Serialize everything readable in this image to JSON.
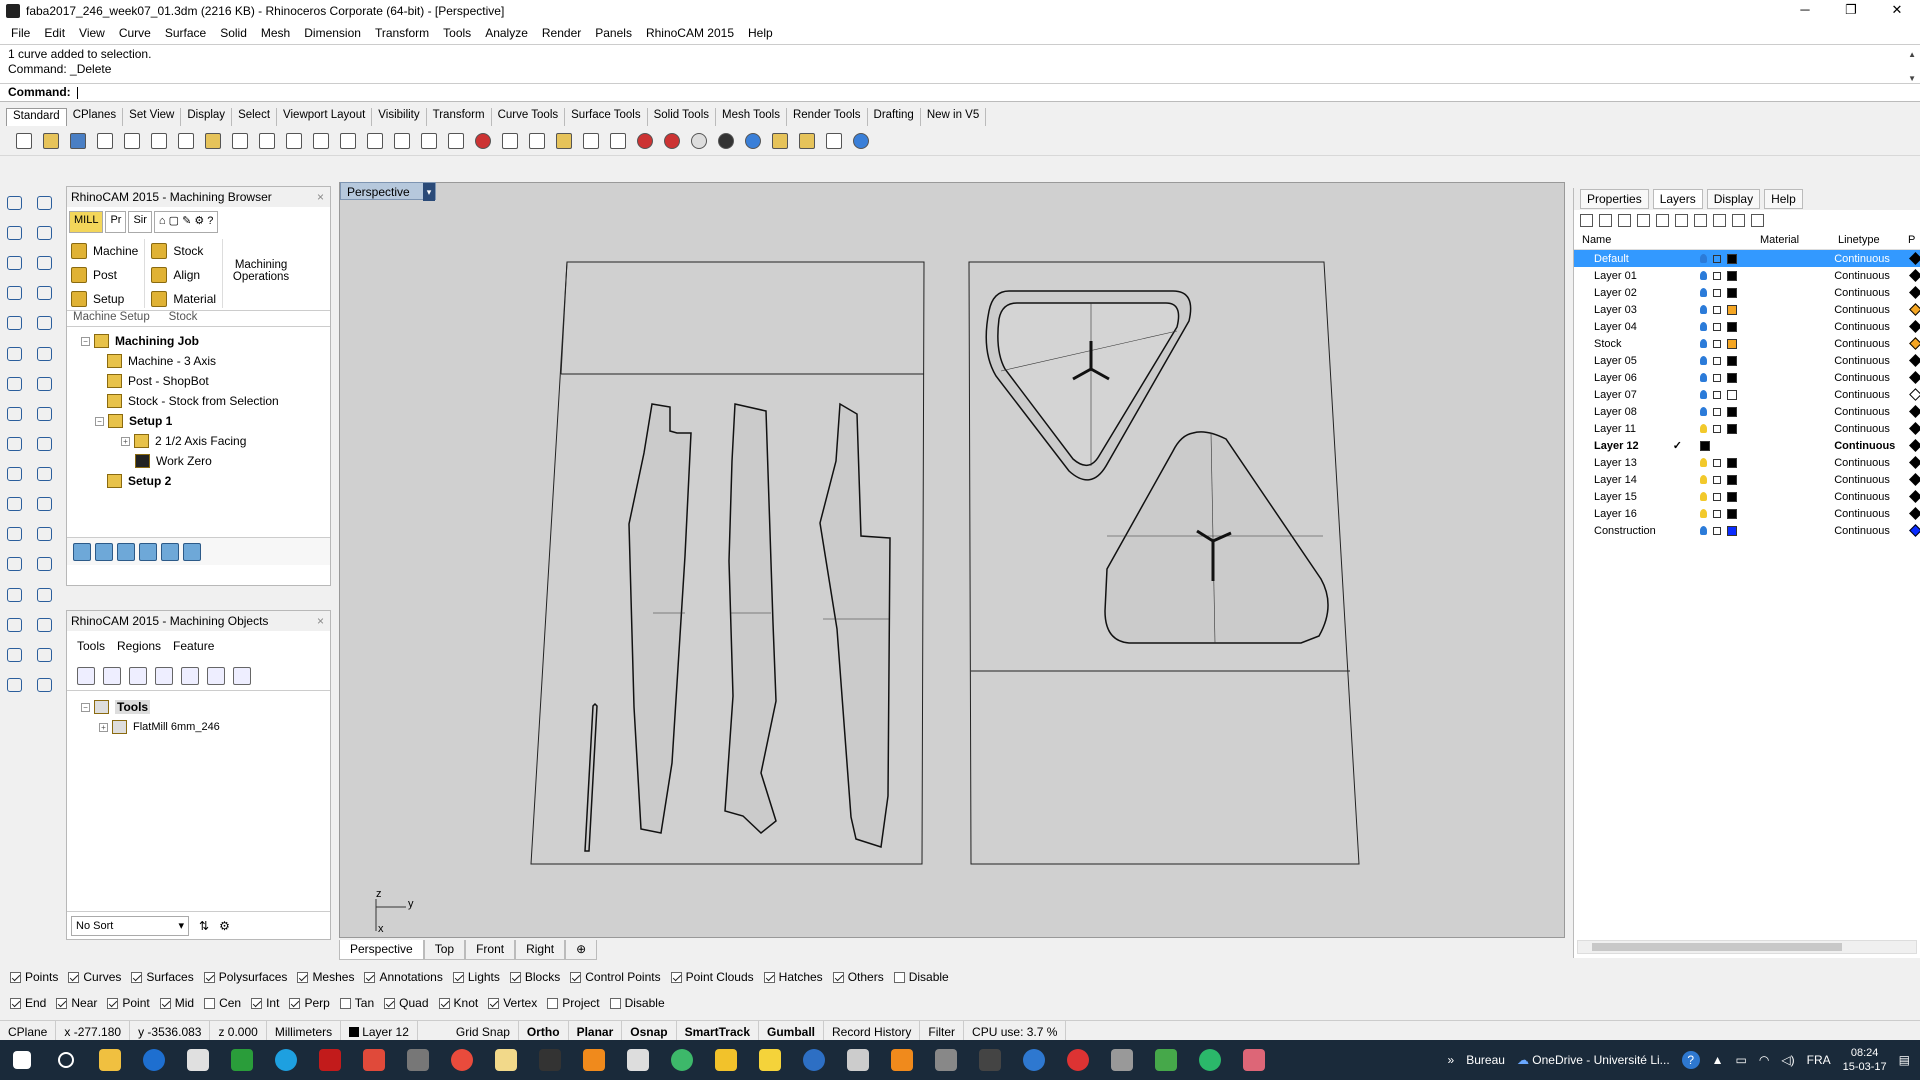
{
  "window": {
    "title": "faba2017_246_week07_01.3dm (2216 KB) - Rhinoceros Corporate (64-bit) - [Perspective]",
    "minimize": "─",
    "maximize": "❐",
    "close": "✕"
  },
  "menu": [
    "File",
    "Edit",
    "View",
    "Curve",
    "Surface",
    "Solid",
    "Mesh",
    "Dimension",
    "Transform",
    "Tools",
    "Analyze",
    "Render",
    "Panels",
    "RhinoCAM 2015",
    "Help"
  ],
  "command": {
    "history": [
      "1 curve added to selection.",
      "Command: _Delete"
    ],
    "prompt": "Command:"
  },
  "toolbar_tabs": [
    "Standard",
    "CPlanes",
    "Set View",
    "Display",
    "Select",
    "Viewport Layout",
    "Visibility",
    "Transform",
    "Curve Tools",
    "Surface Tools",
    "Solid Tools",
    "Mesh Tools",
    "Render Tools",
    "Drafting",
    "New in V5"
  ],
  "browser": {
    "title": "RhinoCAM 2015 - Machining Browser",
    "tabs": [
      "MILL",
      "Pr",
      "Sir"
    ],
    "ribbon": {
      "machine_setup": {
        "items": [
          "Machine",
          "Post",
          "Setup"
        ],
        "label": "Machine Setup"
      },
      "stock": {
        "items": [
          "Stock",
          "Align",
          "Material"
        ],
        "label": "Stock"
      },
      "ops": "Machining Operations"
    },
    "tree": [
      {
        "label": "Machining Job",
        "level": 0,
        "bold": true
      },
      {
        "label": "Machine - 3 Axis",
        "level": 1,
        "bold": false
      },
      {
        "label": "Post - ShopBot",
        "level": 1,
        "bold": false
      },
      {
        "label": "Stock - Stock from Selection",
        "level": 1,
        "bold": false
      },
      {
        "label": "Setup 1",
        "level": 1,
        "bold": true
      },
      {
        "label": "2 1/2 Axis Facing",
        "level": 2,
        "bold": false
      },
      {
        "label": "Work Zero",
        "level": 2,
        "bold": false
      },
      {
        "label": "Setup 2",
        "level": 1,
        "bold": true
      }
    ]
  },
  "objects": {
    "title": "RhinoCAM 2015 - Machining Objects",
    "tabs": [
      "Tools",
      "Regions",
      "Feature"
    ],
    "tree": [
      {
        "label": "Tools",
        "level": 0
      },
      {
        "label": "FlatMill 6mm_246",
        "level": 1
      }
    ],
    "sort": "No Sort"
  },
  "viewport": {
    "name": "Perspective",
    "tabs": [
      "Perspective",
      "Top",
      "Front",
      "Right"
    ],
    "axis_z": "z",
    "axis_y": "y",
    "axis_x": "x"
  },
  "right_panel": {
    "tabs": [
      "Properties",
      "Layers",
      "Display",
      "Help"
    ],
    "headers": {
      "name": "Name",
      "material": "Material",
      "linetype": "Linetype",
      "extra": "P"
    },
    "layers": [
      {
        "name": "Default",
        "on": true,
        "color": "#000000",
        "linetype": "Continuous",
        "selected": true
      },
      {
        "name": "Layer 01",
        "on": true,
        "color": "#000000",
        "linetype": "Continuous"
      },
      {
        "name": "Layer 02",
        "on": true,
        "color": "#000000",
        "linetype": "Continuous"
      },
      {
        "name": "Layer 03",
        "on": true,
        "color": "#f5a623",
        "linetype": "Continuous"
      },
      {
        "name": "Layer 04",
        "on": true,
        "color": "#000000",
        "linetype": "Continuous"
      },
      {
        "name": "Stock",
        "on": true,
        "color": "#f5a623",
        "linetype": "Continuous"
      },
      {
        "name": "Layer 05",
        "on": true,
        "color": "#000000",
        "linetype": "Continuous"
      },
      {
        "name": "Layer 06",
        "on": true,
        "color": "#000000",
        "linetype": "Continuous"
      },
      {
        "name": "Layer 07",
        "on": true,
        "color": "#ffffff",
        "linetype": "Continuous"
      },
      {
        "name": "Layer 08",
        "on": true,
        "color": "#000000",
        "linetype": "Continuous"
      },
      {
        "name": "Layer 11",
        "on": false,
        "color": "#000000",
        "linetype": "Continuous"
      },
      {
        "name": "Layer 12",
        "on": null,
        "color": "#000000",
        "linetype": "Continuous",
        "current": true,
        "mark": "✓"
      },
      {
        "name": "Layer 13",
        "on": false,
        "color": "#000000",
        "linetype": "Continuous"
      },
      {
        "name": "Layer 14",
        "on": false,
        "color": "#000000",
        "linetype": "Continuous"
      },
      {
        "name": "Layer 15",
        "on": false,
        "color": "#000000",
        "linetype": "Continuous"
      },
      {
        "name": "Layer 16",
        "on": false,
        "color": "#000000",
        "linetype": "Continuous"
      },
      {
        "name": "Construction",
        "on": true,
        "color": "#0a2cff",
        "linetype": "Continuous"
      }
    ]
  },
  "filters": [
    {
      "label": "Points",
      "on": true
    },
    {
      "label": "Curves",
      "on": true
    },
    {
      "label": "Surfaces",
      "on": true
    },
    {
      "label": "Polysurfaces",
      "on": true
    },
    {
      "label": "Meshes",
      "on": true
    },
    {
      "label": "Annotations",
      "on": true
    },
    {
      "label": "Lights",
      "on": true
    },
    {
      "label": "Blocks",
      "on": true
    },
    {
      "label": "Control Points",
      "on": true
    },
    {
      "label": "Point Clouds",
      "on": true
    },
    {
      "label": "Hatches",
      "on": true
    },
    {
      "label": "Others",
      "on": true
    },
    {
      "label": "Disable",
      "on": false
    }
  ],
  "osnaps": [
    {
      "label": "End",
      "on": true
    },
    {
      "label": "Near",
      "on": true
    },
    {
      "label": "Point",
      "on": true
    },
    {
      "label": "Mid",
      "on": true
    },
    {
      "label": "Cen",
      "on": false
    },
    {
      "label": "Int",
      "on": true
    },
    {
      "label": "Perp",
      "on": true
    },
    {
      "label": "Tan",
      "on": false
    },
    {
      "label": "Quad",
      "on": true
    },
    {
      "label": "Knot",
      "on": true
    },
    {
      "label": "Vertex",
      "on": true
    },
    {
      "label": "Project",
      "on": false
    },
    {
      "label": "Disable",
      "on": false
    }
  ],
  "status": {
    "cplane": "CPlane",
    "x": "x -277.180",
    "y": "y -3536.083",
    "z": "z 0.000",
    "units": "Millimeters",
    "layer": "Layer 12",
    "grid_snap": "Grid Snap",
    "ortho": "Ortho",
    "planar": "Planar",
    "osnap": "Osnap",
    "smarttrack": "SmartTrack",
    "gumball": "Gumball",
    "record": "Record History",
    "filter": "Filter",
    "cpu": "CPU use: 3.7 %"
  },
  "taskbar": {
    "bureau": "Bureau",
    "onedrive": "OneDrive - Université Li...",
    "lang": "FRA",
    "time": "08:24",
    "date": "15-03-17"
  }
}
